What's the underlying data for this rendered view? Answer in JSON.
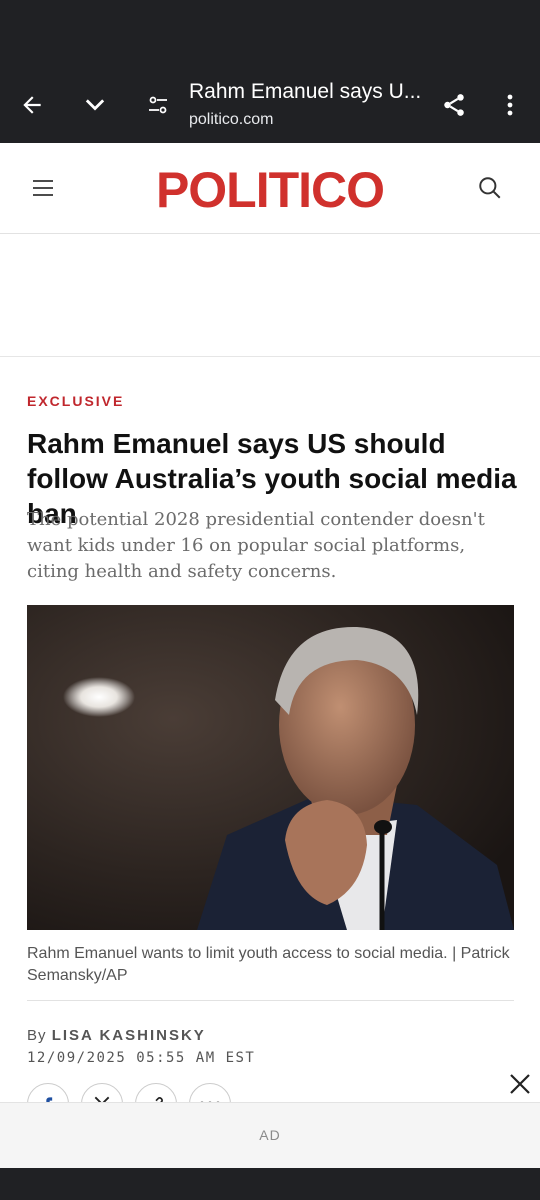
{
  "browser": {
    "tab_title": "Rahm Emanuel says U...",
    "url": "politico.com",
    "icons": [
      "back-arrow-icon",
      "chevron-down-icon",
      "site-settings-icon",
      "share-icon",
      "more-vert-icon"
    ]
  },
  "site": {
    "logo": "POLITICO",
    "brand_color": "#d0312d",
    "icons": [
      "hamburger-menu-icon",
      "search-icon"
    ]
  },
  "article": {
    "kicker": "EXCLUSIVE",
    "headline": "Rahm Emanuel says US should follow Australia’s youth social media ban",
    "dek": "The potential 2028 presidential contender doesn't want kids under 16 on popular social platforms, citing health and safety concerns.",
    "image_caption": "Rahm Emanuel wants to limit youth access to social media. | Patrick Semansky/AP",
    "byline_prefix": "By",
    "author": "LISA KASHINSKY",
    "date": "12/09/2025 05:55 AM EST",
    "share_icons": [
      "facebook-icon",
      "x-icon",
      "link-icon",
      "more-horiz-icon"
    ]
  },
  "ad": {
    "label": "AD"
  }
}
